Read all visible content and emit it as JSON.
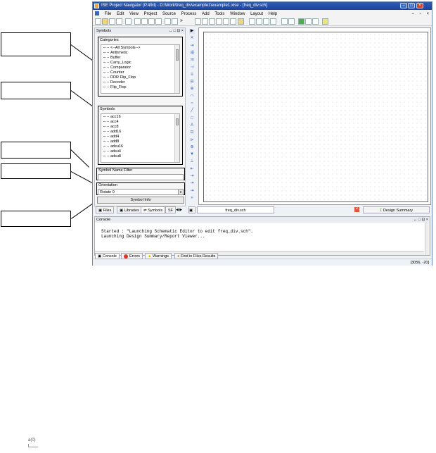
{
  "window": {
    "title": "ISE Project Navigator (P.49d) - D:\\Work\\freq_div\\example1\\example1.xise - [freq_div.sch]",
    "controls": {
      "minimize": "–",
      "maximize": "□",
      "close": "×"
    }
  },
  "menu": [
    "File",
    "Edit",
    "View",
    "Project",
    "Source",
    "Process",
    "Add",
    "Tools",
    "Window",
    "Layout",
    "Help"
  ],
  "menu_right": {
    "minimize": "–",
    "restore": "▫",
    "close": "×"
  },
  "left_pane": {
    "header": "Symbols",
    "header_controls": "↔ □ ⊡ ×",
    "categories": {
      "label": "Categories",
      "items": [
        "<--All Symbols-->",
        "Arithmetic",
        "Buffer",
        "Carry_Logic",
        "Comparator",
        "Counter",
        "DDR Flip_Flop",
        "Decoder",
        "Flip_Flop"
      ]
    },
    "symbols": {
      "label": "Symbols",
      "items": [
        "acc16",
        "acc4",
        "acc8",
        "add16",
        "add4",
        "add8",
        "adsu16",
        "adsu4",
        "adsu8"
      ]
    },
    "filter": {
      "label": "Symbol Name Filter",
      "value": ""
    },
    "orientation": {
      "label": "Orientation",
      "value": "Rotate 0",
      "arrow": "▼"
    },
    "symbol_info_button": "Symbol Info"
  },
  "left_tabs": [
    "Files",
    "Libraries",
    "Symbols",
    "SF"
  ],
  "left_tab_arrows": "◀ ▶",
  "tool_column": [
    "▶",
    "✕",
    "⇥",
    "⇶",
    "⇉",
    "⊣",
    "≡",
    "⊟",
    "⊕",
    "◠",
    "○",
    "╱",
    "□",
    "A",
    "⊡",
    "⊳",
    "⊕",
    "▼",
    "⊥",
    "⇤",
    "⇥",
    "⇥",
    "⇥",
    "»"
  ],
  "toolbar": {
    "overflow": "»"
  },
  "editor_tabs": [
    {
      "label": "freq_div.sch",
      "close": "×"
    },
    {
      "label": "Design Summary",
      "close": "×"
    }
  ],
  "console": {
    "header": "Console",
    "header_controls": "↔ □ ⊡ ×",
    "text": "Started : \"Launching Schematic Editor to edit freq_div.sch\".\nLaunching Design Summary/Report Viewer..."
  },
  "bottom_tabs": [
    "Console",
    "Errors",
    "Warnings",
    "Find in Files Results"
  ],
  "status": {
    "coordinates": "[3056, -20]"
  },
  "footer_icon_label": "a(0)"
}
